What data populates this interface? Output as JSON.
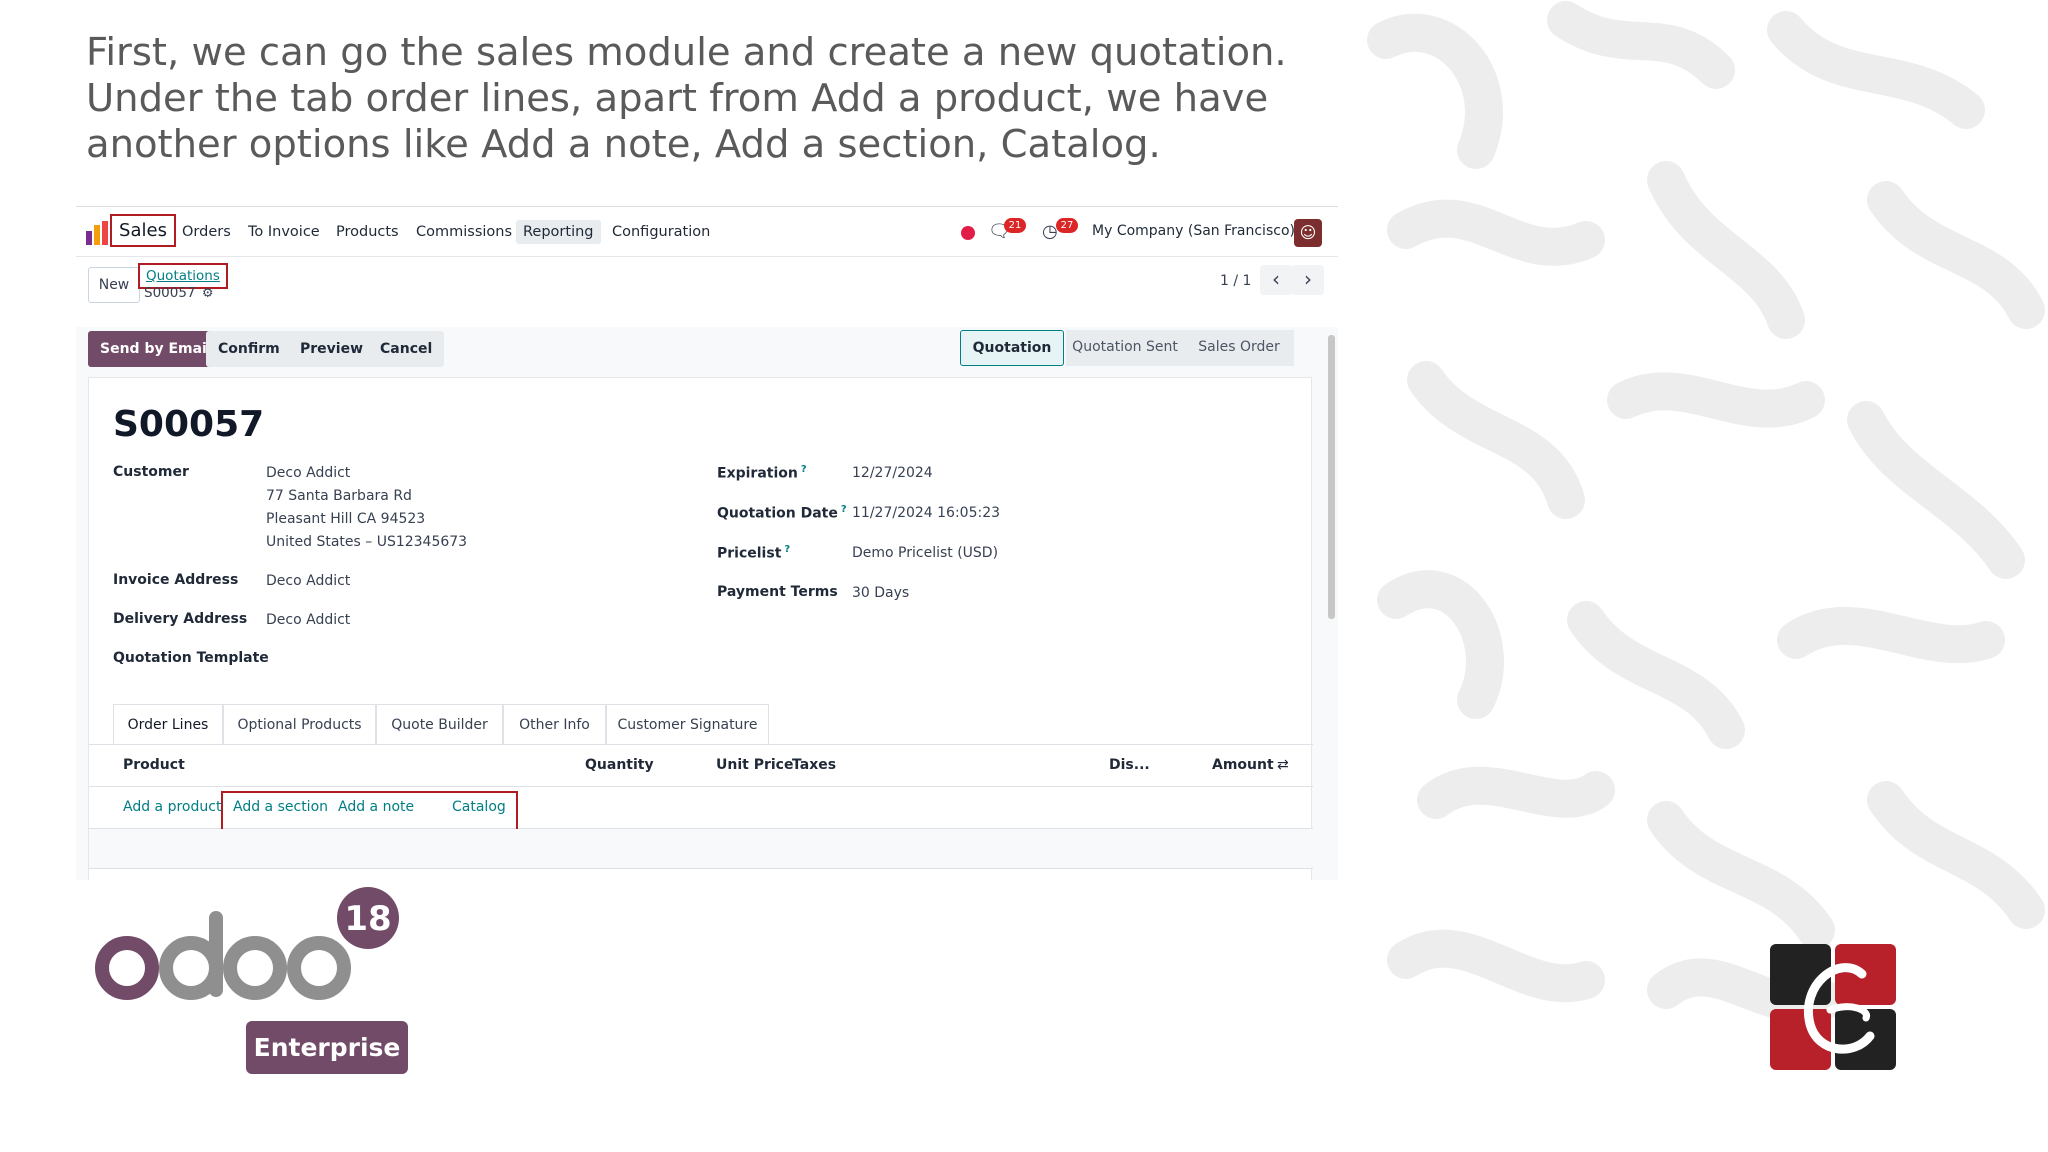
{
  "slide": {
    "intro_line1": "First, we can go the sales module and create a new quotation.",
    "intro_line2": "Under the tab order lines, apart from Add a product, we have",
    "intro_line3": "another options like Add a note, Add a section, Catalog."
  },
  "navbar": {
    "app": "Sales",
    "items": [
      "Orders",
      "To Invoice",
      "Products",
      "Commissions",
      "Reporting",
      "Configuration"
    ],
    "active": "Reporting",
    "messages_badge": "21",
    "activities_badge": "27",
    "company": "My Company (San Francisco)"
  },
  "control": {
    "new_label": "New",
    "breadcrumb": "Quotations",
    "record_id": "S00057",
    "pager": "1 / 1"
  },
  "actions": {
    "send_email": "Send by Email",
    "confirm": "Confirm",
    "preview": "Preview",
    "cancel": "Cancel",
    "stages": [
      "Quotation",
      "Quotation Sent",
      "Sales Order"
    ]
  },
  "record": {
    "name": "S00057",
    "customer_label": "Customer",
    "customer_name": "Deco Addict",
    "address_line1": "77 Santa Barbara Rd",
    "address_line2": "Pleasant Hill CA 94523",
    "address_line3": "United States – US12345673",
    "invoice_label": "Invoice Address",
    "invoice_value": "Deco Addict",
    "delivery_label": "Delivery Address",
    "delivery_value": "Deco Addict",
    "template_label": "Quotation Template",
    "expiration_label": "Expiration",
    "expiration_value": "12/27/2024",
    "qdate_label": "Quotation Date",
    "qdate_value": "11/27/2024 16:05:23",
    "pricelist_label": "Pricelist",
    "pricelist_value": "Demo Pricelist (USD)",
    "terms_label": "Payment Terms",
    "terms_value": "30 Days",
    "help_mark": "?"
  },
  "tabs": [
    "Order Lines",
    "Optional Products",
    "Quote Builder",
    "Other Info",
    "Customer Signature"
  ],
  "table": {
    "columns": [
      "Product",
      "Quantity",
      "Unit Price",
      "Taxes",
      "Dis...",
      "Amount"
    ],
    "links": [
      "Add a product",
      "Add a section",
      "Add a note",
      "Catalog"
    ]
  },
  "branding": {
    "version": "18",
    "edition": "Enterprise",
    "odoo_purple": "#714b67",
    "odoo_gray": "#8f8f8f",
    "highlight_red": "#b01c22",
    "link_teal": "#017e84"
  }
}
